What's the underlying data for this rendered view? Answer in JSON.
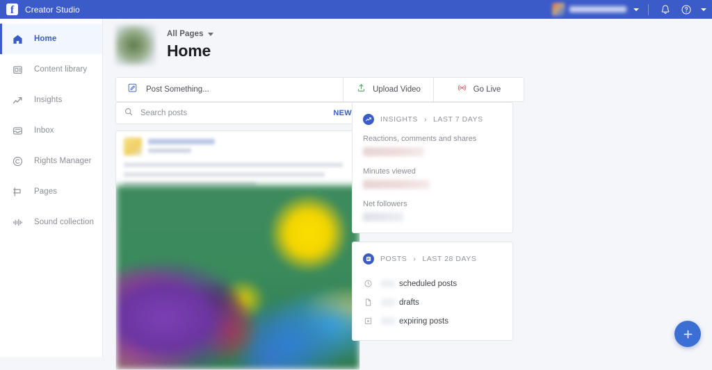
{
  "topbar": {
    "brand": "Creator Studio",
    "logo_icon": "facebook-logo-icon",
    "account_caret_icon": "chevron-down-icon",
    "notifications_icon": "bell-icon",
    "help_icon": "question-circle-icon",
    "menu_caret_icon": "chevron-down-icon",
    "background_color": "#3b5bc9"
  },
  "sidebar": {
    "items": [
      {
        "label": "Home",
        "icon": "home-icon",
        "active": true
      },
      {
        "label": "Content library",
        "icon": "content-library-icon",
        "active": false
      },
      {
        "label": "Insights",
        "icon": "insights-chart-icon",
        "active": false
      },
      {
        "label": "Inbox",
        "icon": "inbox-tray-icon",
        "active": false
      },
      {
        "label": "Rights Manager",
        "icon": "copyright-circle-icon",
        "active": false
      },
      {
        "label": "Pages",
        "icon": "flag-icon",
        "active": false
      },
      {
        "label": "Sound collection",
        "icon": "audio-waveform-icon",
        "active": false
      }
    ],
    "active_color": "#3b5bc9"
  },
  "page_header": {
    "selector_label": "All Pages",
    "selector_caret_icon": "chevron-down-icon",
    "title": "Home",
    "thumbnail_icon": "page-thumbnail"
  },
  "composer": {
    "post_label": "Post Something...",
    "post_icon": "compose-pencil-icon",
    "post_icon_color": "#4267d8",
    "upload_label": "Upload Video",
    "upload_icon": "upload-arrow-icon",
    "upload_icon_color": "#45b15d",
    "golive_label": "Go Live",
    "golive_icon": "broadcast-icon",
    "golive_icon_color": "#e8566c"
  },
  "search": {
    "placeholder": "Search posts",
    "icon": "search-icon",
    "new_badge": "NEW",
    "new_badge_color": "#3b5bc9"
  },
  "feed": {
    "post": {
      "author_name_redacted": "",
      "timestamp_redacted": "",
      "body_redacted": "",
      "image_alt": "blurred-post-image"
    }
  },
  "insights_card": {
    "badge_icon": "insights-chart-icon",
    "title": "INSIGHTS",
    "separator": "›",
    "range": "LAST 7 DAYS",
    "metrics": [
      {
        "name": "Reactions, comments and shares",
        "value_redacted": ""
      },
      {
        "name": "Minutes viewed",
        "value_redacted": ""
      },
      {
        "name": "Net followers",
        "value_redacted": ""
      }
    ]
  },
  "posts_card": {
    "badge_icon": "post-document-icon",
    "title": "POSTS",
    "separator": "›",
    "range": "LAST 28 DAYS",
    "rows": [
      {
        "icon": "clock-icon",
        "count_redacted": "",
        "label": "scheduled posts"
      },
      {
        "icon": "document-icon",
        "count_redacted": "",
        "label": "drafts"
      },
      {
        "icon": "expiring-icon",
        "count_redacted": "",
        "label": "expiring posts"
      }
    ]
  },
  "fab": {
    "icon": "plus-icon",
    "color": "#3b6fd4"
  }
}
